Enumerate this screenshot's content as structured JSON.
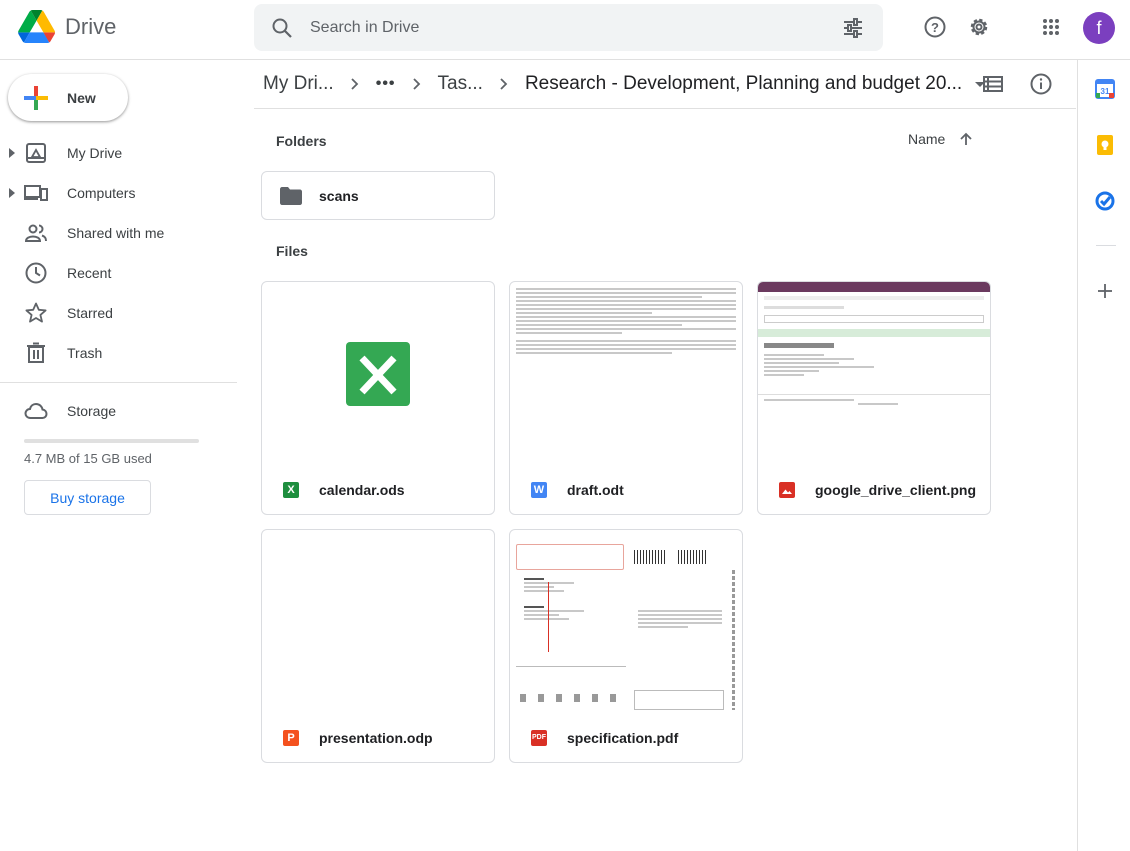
{
  "app": {
    "name": "Drive",
    "user_initial": "f"
  },
  "search": {
    "placeholder": "Search in Drive"
  },
  "sidebar": {
    "new_label": "New",
    "items": [
      {
        "label": "My Drive",
        "icon": "my-drive-icon",
        "expandable": true
      },
      {
        "label": "Computers",
        "icon": "computer-icon",
        "expandable": true
      },
      {
        "label": "Shared with me",
        "icon": "people-icon",
        "expandable": false
      },
      {
        "label": "Recent",
        "icon": "clock-icon",
        "expandable": false
      },
      {
        "label": "Starred",
        "icon": "star-icon",
        "expandable": false
      },
      {
        "label": "Trash",
        "icon": "trash-icon",
        "expandable": false
      }
    ],
    "storage": {
      "label": "Storage",
      "used_text": "4.7 MB of 15 GB used",
      "fraction_used": 0.0003,
      "buy_label": "Buy storage"
    }
  },
  "breadcrumb": {
    "items": [
      "My Dri...",
      "•••",
      "Tas...",
      "Research - Development, Planning and budget 20..."
    ]
  },
  "content": {
    "folders_label": "Folders",
    "files_label": "Files",
    "sort_label": "Name",
    "folders": [
      {
        "name": "scans"
      }
    ],
    "files": [
      {
        "name": "calendar.ods",
        "type": "sheet",
        "badge": "X",
        "color": "#1e8e3e"
      },
      {
        "name": "draft.odt",
        "type": "doc",
        "badge": "W",
        "color": "#4285f4"
      },
      {
        "name": "google_drive_client.png",
        "type": "image",
        "badge": "",
        "color": "#d93025"
      },
      {
        "name": "presentation.odp",
        "type": "slides",
        "badge": "P",
        "color": "#f4511e"
      },
      {
        "name": "specification.pdf",
        "type": "pdf",
        "badge": "PDF",
        "color": "#d93025"
      }
    ]
  },
  "rail": {
    "calendar_day": "31"
  },
  "colors": {
    "accent": "#1a73e8",
    "avatar": "#7b3fbf",
    "sheets_green": "#34a853"
  }
}
